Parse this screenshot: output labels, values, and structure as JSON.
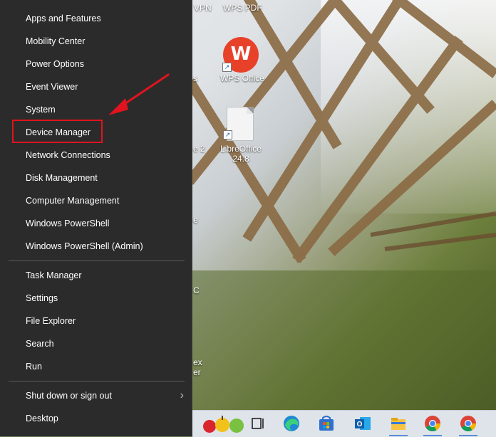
{
  "menu": {
    "groups": [
      [
        "Apps and Features",
        "Mobility Center",
        "Power Options",
        "Event Viewer",
        "System",
        "Device Manager",
        "Network Connections",
        "Disk Management",
        "Computer Management",
        "Windows PowerShell",
        "Windows PowerShell (Admin)"
      ],
      [
        "Task Manager",
        "Settings",
        "File Explorer",
        "Search",
        "Run"
      ],
      [
        "Shut down or sign out",
        "Desktop"
      ]
    ],
    "highlighted": "Device Manager",
    "submenu_chevron": "›"
  },
  "desktop": {
    "top_labels": [
      "VPN",
      "WPS PDF"
    ],
    "wps_logo_letter": "W",
    "icons": [
      {
        "label": "WPS Office"
      },
      {
        "label_line1": "LibreOffice",
        "label_line2": "24.8"
      }
    ],
    "partial_labels": [
      "s",
      "e 2",
      "e",
      "C",
      "ex",
      "er"
    ]
  },
  "taskbar": {
    "icons": [
      "fruit-icon",
      "task-view-icon",
      "edge-icon",
      "store-icon",
      "outlook-icon",
      "file-explorer-icon",
      "chrome-icon",
      "chrome-icon"
    ],
    "outlook_letter": "O"
  },
  "colors": {
    "menu_bg": "#2b2b2b",
    "menu_text": "#ffffff",
    "highlight": "#e0141e",
    "arrow": "#e0141e"
  }
}
